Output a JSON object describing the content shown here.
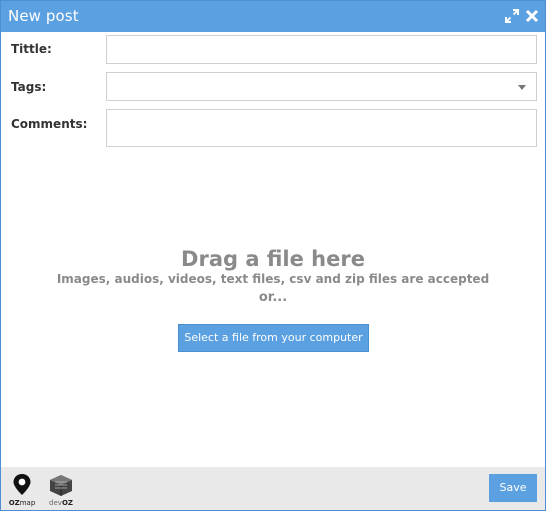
{
  "window": {
    "title": "New post",
    "accent_color": "#5ba0e0"
  },
  "form": {
    "title_label": "Tittle:",
    "title_value": "",
    "tags_label": "Tags:",
    "tags_value": "",
    "comments_label": "Comments:",
    "comments_value": ""
  },
  "dropzone": {
    "heading": "Drag a file here",
    "subheading": "Images, audios, videos, text files, csv and zip files are accepted",
    "or_text": "or...",
    "button_label": "Select a file from your computer"
  },
  "footer": {
    "save_label": "Save",
    "logos": [
      {
        "name": "ozmap",
        "text_prefix": "OZ",
        "text_suffix": "map"
      },
      {
        "name": "devoz",
        "text_prefix": "dev",
        "text_suffix": "OZ"
      }
    ]
  },
  "icons": {
    "expand": "expand-icon",
    "close": "close-icon",
    "dropdown": "chevron-down-icon"
  }
}
